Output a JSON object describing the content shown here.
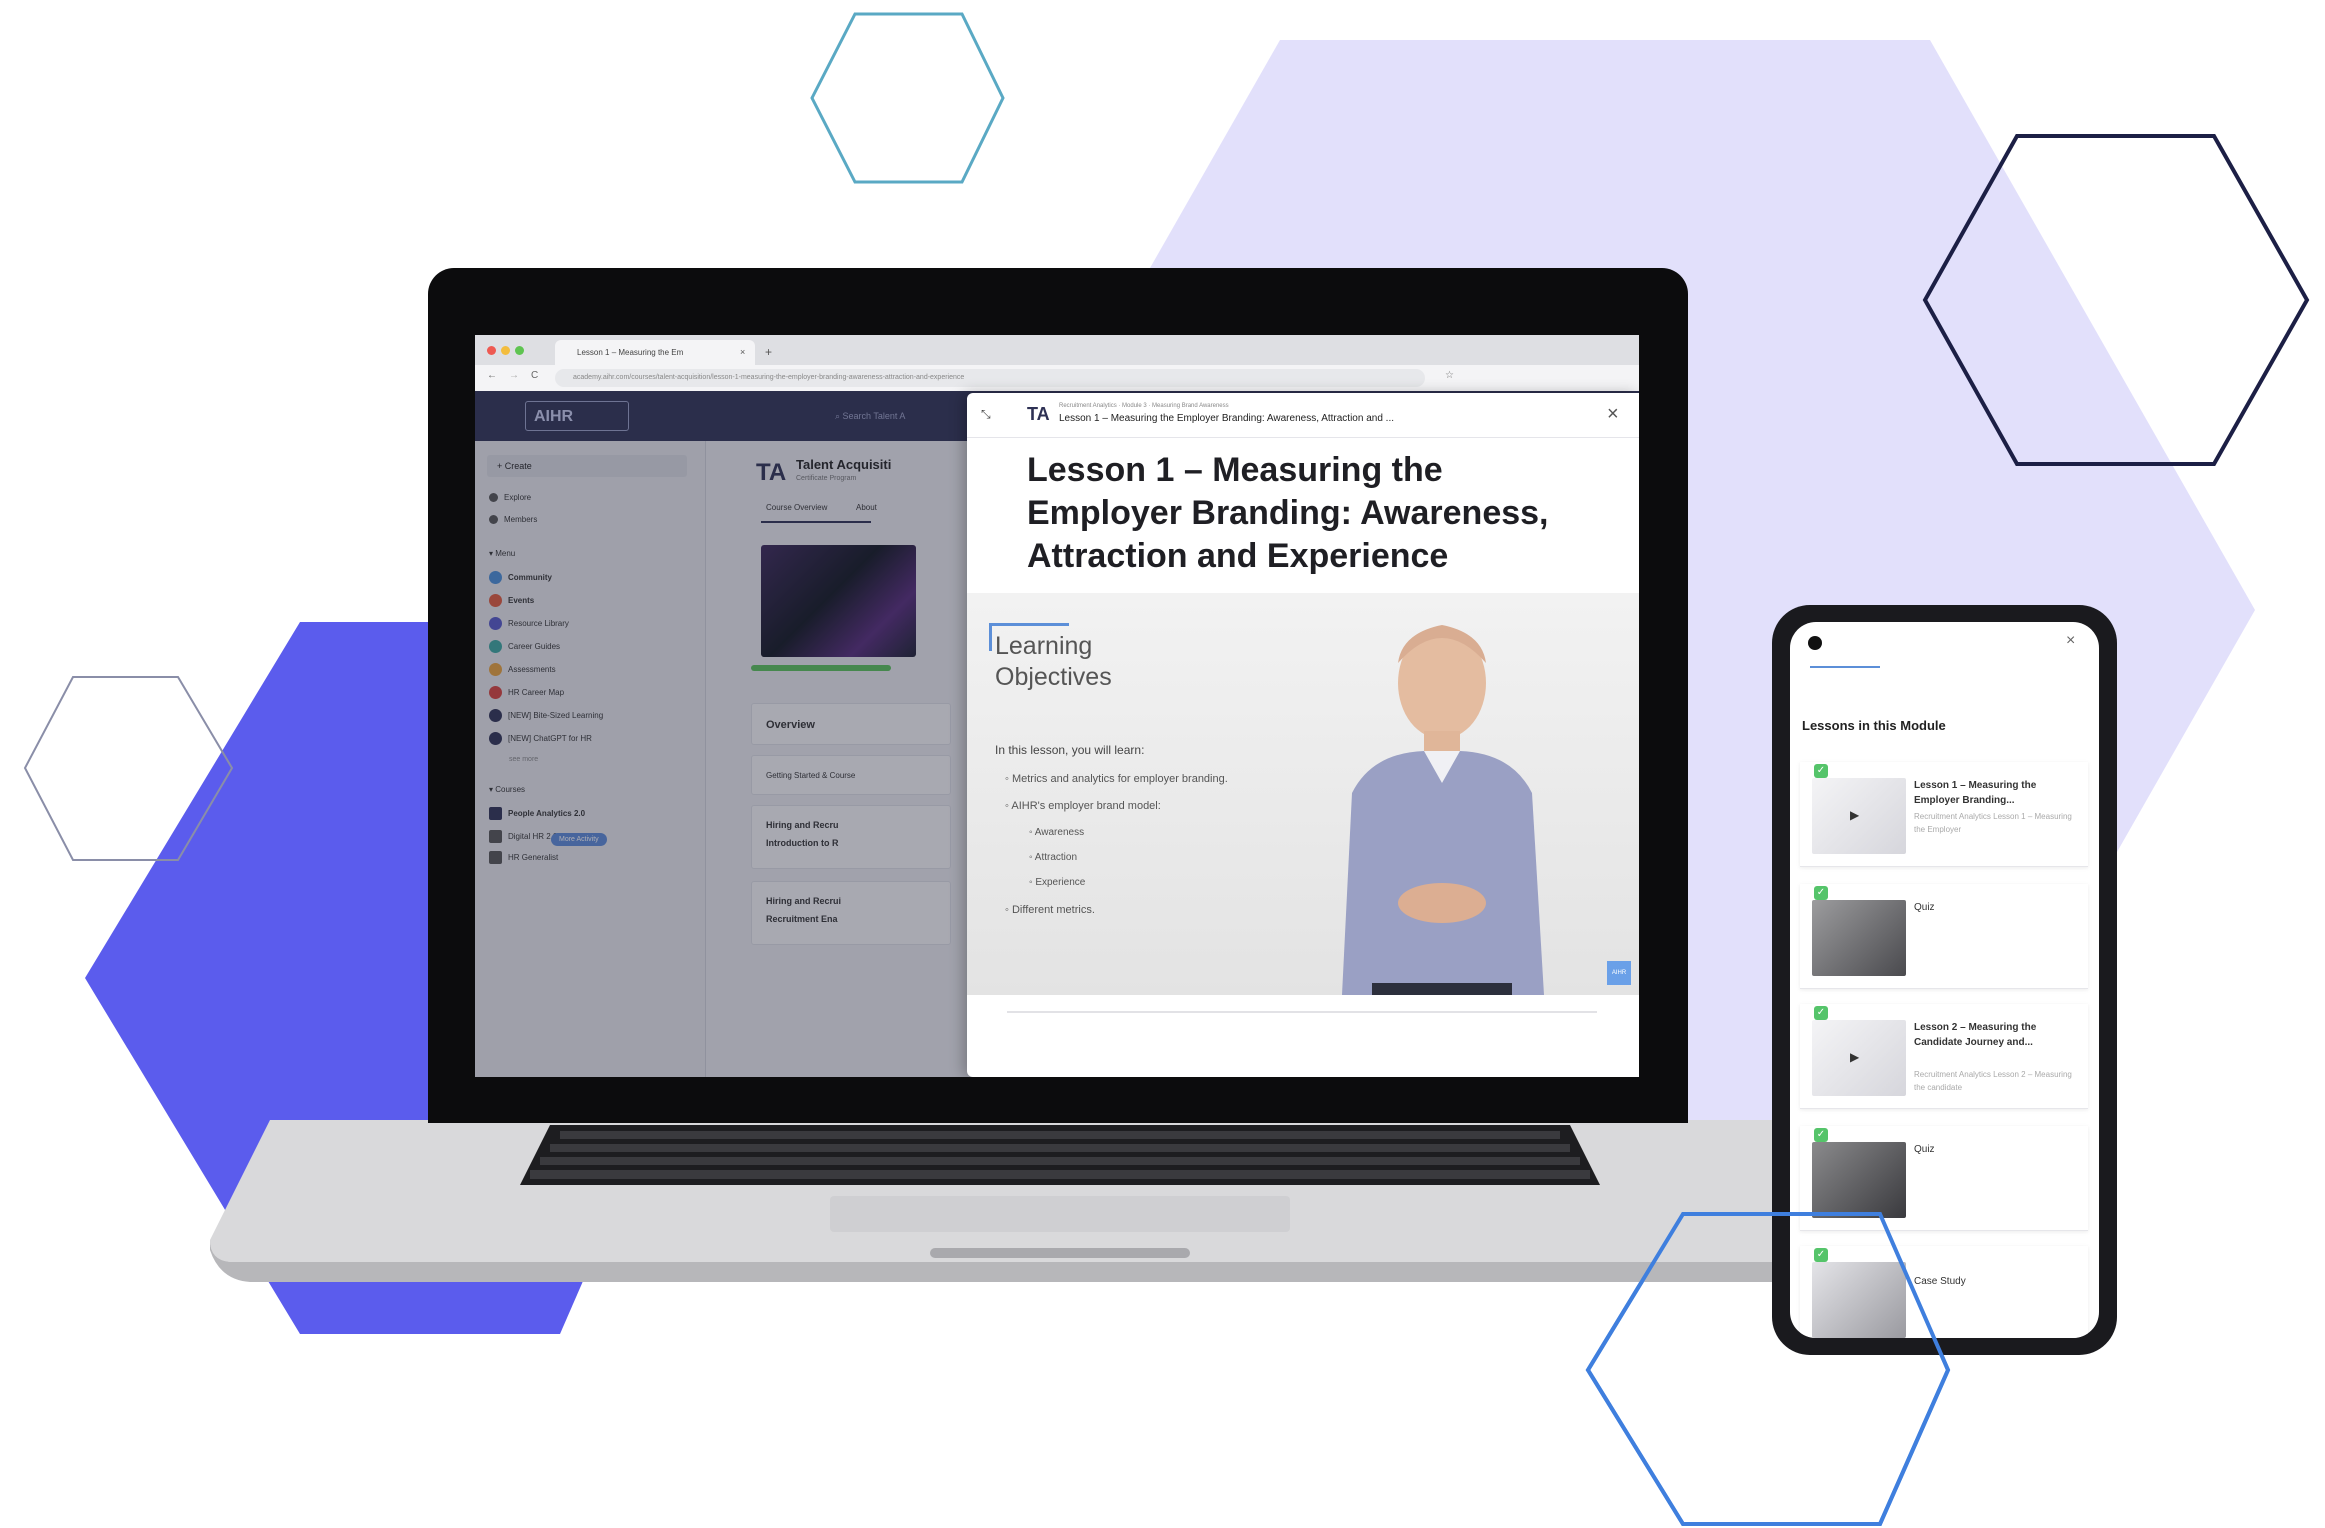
{
  "colors": {
    "purple_blob": "#5b5ced",
    "lavender_blob": "#e2e0fb",
    "hex_teal": "#5aa9c4",
    "hex_navy": "#1c1f45",
    "hex_blue": "#3f7fde",
    "hex_gray": "#8a8ea8"
  },
  "browser": {
    "tab_title": "Lesson 1 – Measuring the Em",
    "tab_close": "×",
    "tab_new": "+",
    "nav_back": "←",
    "nav_forward": "→",
    "nav_reload": "C",
    "url": "academy.aihr.com/courses/talent-acquisition/lesson-1-measuring-the-employer-branding-awareness-attraction-and-experience"
  },
  "app": {
    "logo": "AIHR",
    "search_placeholder": "Search Talent A",
    "sidebar": {
      "create": "+ Create",
      "explore": "Explore",
      "members": "Members",
      "menu_header": "▾ Menu",
      "menu_items": [
        "Community",
        "Events",
        "Resource Library",
        "Career Guides",
        "Assessments",
        "HR Career Map",
        "[NEW] Bite-Sized Learning",
        "[NEW] ChatGPT for HR"
      ],
      "see_more": "see more",
      "courses_header": "▾ Courses",
      "courses": [
        "People Analytics 2.0",
        "Digital HR 2.0",
        "HR Generalist"
      ],
      "more_button": "More Activity"
    },
    "main": {
      "badge": "TA",
      "title": "Talent Acquisiti",
      "subtitle": "Certificate Program",
      "tabs": [
        "Course Overview",
        "About"
      ],
      "overview": "Overview",
      "row_getting_started": "Getting Started & Course",
      "row_hiring_1_a": "Hiring and Recru",
      "row_hiring_1_b": "Introduction to R",
      "row_hiring_2_a": "Hiring and Recrui",
      "row_hiring_2_b": "Recruitment Ena"
    }
  },
  "lesson": {
    "badge": "TA",
    "breadcrumb": "Recruitment Analytics · Module 3 · Measuring Brand Awareness",
    "header_title": "Lesson 1 – Measuring the Employer Branding: Awareness, Attraction and ...",
    "close": "×",
    "expand": "⤡",
    "title": "Lesson 1 – Measuring the Employer Branding: Awareness, Attraction and Experience",
    "video": {
      "lo_title_line1": "Learning",
      "lo_title_line2": "Objectives",
      "intro": "In this lesson, you will learn:",
      "bullets": [
        "Metrics and analytics for employer branding.",
        "AIHR's employer brand model:"
      ],
      "sub_bullets": [
        "Awareness",
        "Attraction",
        "Experience"
      ],
      "last_bullet": "Different metrics.",
      "corner_tag": "AIHR"
    }
  },
  "phone": {
    "close": "×",
    "heading": "Lessons in this Module",
    "items": [
      {
        "title": "Lesson 1 – Measuring the Employer Branding...",
        "sub": "Recruitment Analytics Lesson 1 – Measuring the Employer"
      },
      {
        "title": "Quiz",
        "sub": ""
      },
      {
        "title": "Lesson 2 – Measuring the Candidate Journey and...",
        "sub": "Recruitment Analytics Lesson 2 – Measuring the candidate"
      },
      {
        "title": "Quiz",
        "sub": ""
      },
      {
        "title": "Case Study",
        "sub": ""
      }
    ]
  }
}
